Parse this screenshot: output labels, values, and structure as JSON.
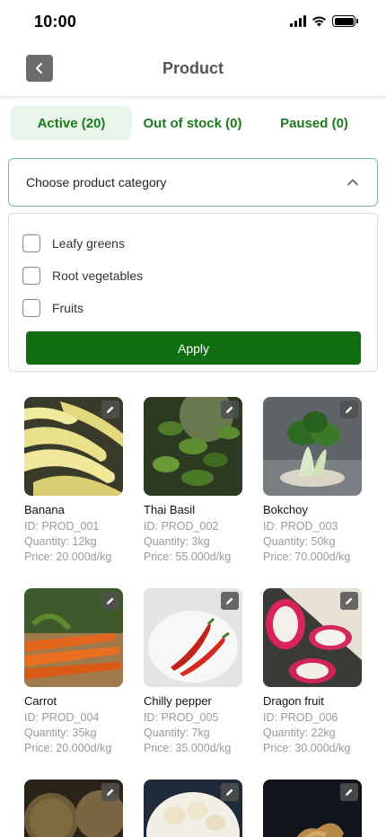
{
  "status_bar": {
    "time": "10:00"
  },
  "header": {
    "title": "Product",
    "back_icon": "chevron-left-icon"
  },
  "tabs": [
    {
      "label": "Active (20)",
      "active": true
    },
    {
      "label": "Out of stock (0)",
      "active": false
    },
    {
      "label": "Paused (0)",
      "active": false
    }
  ],
  "category_select": {
    "label": "Choose product category",
    "icon": "chevron-up-icon"
  },
  "category_options": [
    {
      "label": "Leafy greens",
      "checked": false
    },
    {
      "label": "Root vegetables",
      "checked": false
    },
    {
      "label": "Fruits",
      "checked": false
    }
  ],
  "apply_label": "Apply",
  "colors": {
    "accent": "#1c7a1c",
    "button": "#0f6e0f",
    "tab_active_bg": "#e8f5ea",
    "border": "#7fb79a"
  },
  "products": [
    {
      "name": "Banana",
      "id": "ID: PROD_001",
      "quantity": "Quantity: 12kg",
      "price": "Price: 20.000d/kg"
    },
    {
      "name": "Thai Basil",
      "id": "ID: PROD_002",
      "quantity": "Quantity: 3kg",
      "price": "Price: 55.000d/kg"
    },
    {
      "name": "Bokchoy",
      "id": "ID: PROD_003",
      "quantity": "Quantity: 50kg",
      "price": "Price: 70.000d/kg"
    },
    {
      "name": "Carrot",
      "id": "ID: PROD_004",
      "quantity": "Quantity: 35kg",
      "price": "Price: 20.000d/kg"
    },
    {
      "name": "Chilly pepper",
      "id": "ID: PROD_005",
      "quantity": "Quantity: 7kg",
      "price": "Price: 35.000d/kg"
    },
    {
      "name": "Dragon fruit",
      "id": "ID: PROD_006",
      "quantity": "Quantity: 22kg",
      "price": "Price: 30.000d/kg"
    }
  ]
}
